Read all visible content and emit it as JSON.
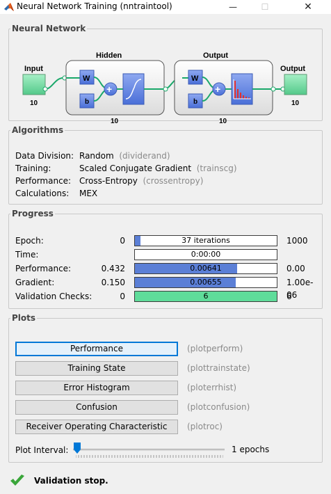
{
  "window": {
    "title": "Neural Network Training (nntraintool)",
    "minimize": "—",
    "maximize": "☐",
    "close": "✕"
  },
  "network": {
    "legend": "Neural Network",
    "input_label": "Input",
    "input_size": "10",
    "hidden_title": "Hidden",
    "hidden_size": "10",
    "output_title": "Output",
    "output_size": "10",
    "output_label": "Output",
    "output_out_size": "10",
    "weight_label": "W",
    "bias_label": "b",
    "plus": "+"
  },
  "algorithms": {
    "legend": "Algorithms",
    "rows": [
      {
        "label": "Data Division:",
        "value": "Random",
        "fn": "(dividerand)"
      },
      {
        "label": "Training:",
        "value": "Scaled Conjugate Gradient",
        "fn": "(trainscg)"
      },
      {
        "label": "Performance:",
        "value": "Cross-Entropy",
        "fn": "(crossentropy)"
      },
      {
        "label": "Calculations:",
        "value": "MEX",
        "fn": ""
      }
    ]
  },
  "progress": {
    "legend": "Progress",
    "rows": [
      {
        "label": "Epoch:",
        "start": "0",
        "bar_text": "37 iterations",
        "end": "1000",
        "fill": 0.037
      },
      {
        "label": "Time:",
        "start": "",
        "bar_text": "0:00:00",
        "end": "",
        "fill": 0
      },
      {
        "label": "Performance:",
        "start": "0.432",
        "bar_text": "0.00641",
        "end": "0.00",
        "fill": 0.72
      },
      {
        "label": "Gradient:",
        "start": "0.150",
        "bar_text": "0.00655",
        "end": "1.00e-06",
        "fill": 0.71
      },
      {
        "label": "Validation Checks:",
        "start": "0",
        "bar_text": "6",
        "end": "6",
        "fill": 1.0
      }
    ],
    "colors": {
      "blue": "#5b7fd6",
      "green": "#5fdc9a"
    }
  },
  "plots": {
    "legend": "Plots",
    "buttons": [
      {
        "label": "Performance",
        "fn": "(plotperform)"
      },
      {
        "label": "Training State",
        "fn": "(plottrainstate)"
      },
      {
        "label": "Error Histogram",
        "fn": "(ploterrhist)"
      },
      {
        "label": "Confusion",
        "fn": "(plotconfusion)"
      },
      {
        "label": "Receiver Operating Characteristic",
        "fn": "(plotroc)"
      }
    ],
    "interval_label": "Plot Interval:",
    "interval_value": "1 epochs"
  },
  "status": {
    "text": "Validation stop."
  }
}
